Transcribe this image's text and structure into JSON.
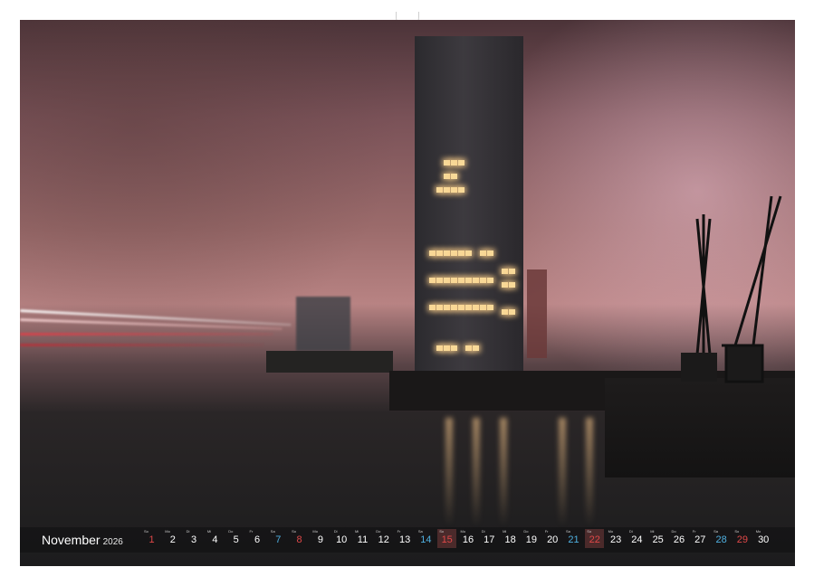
{
  "calendar": {
    "month": "November",
    "year": "2026",
    "days": [
      {
        "dow": "So",
        "num": "1",
        "type": "sun"
      },
      {
        "dow": "Mo",
        "num": "2",
        "type": "wk"
      },
      {
        "dow": "Di",
        "num": "3",
        "type": "wk"
      },
      {
        "dow": "Mi",
        "num": "4",
        "type": "wk"
      },
      {
        "dow": "Do",
        "num": "5",
        "type": "wk"
      },
      {
        "dow": "Fr",
        "num": "6",
        "type": "wk"
      },
      {
        "dow": "Sa",
        "num": "7",
        "type": "sat"
      },
      {
        "dow": "So",
        "num": "8",
        "type": "sun"
      },
      {
        "dow": "Mo",
        "num": "9",
        "type": "wk"
      },
      {
        "dow": "Di",
        "num": "10",
        "type": "wk"
      },
      {
        "dow": "Mi",
        "num": "11",
        "type": "wk"
      },
      {
        "dow": "Do",
        "num": "12",
        "type": "wk"
      },
      {
        "dow": "Fr",
        "num": "13",
        "type": "wk"
      },
      {
        "dow": "Sa",
        "num": "14",
        "type": "sat"
      },
      {
        "dow": "So",
        "num": "15",
        "type": "hol"
      },
      {
        "dow": "Mo",
        "num": "16",
        "type": "wk"
      },
      {
        "dow": "Di",
        "num": "17",
        "type": "wk"
      },
      {
        "dow": "Mi",
        "num": "18",
        "type": "wk"
      },
      {
        "dow": "Do",
        "num": "19",
        "type": "wk"
      },
      {
        "dow": "Fr",
        "num": "20",
        "type": "wk"
      },
      {
        "dow": "Sa",
        "num": "21",
        "type": "sat"
      },
      {
        "dow": "So",
        "num": "22",
        "type": "hol"
      },
      {
        "dow": "Mo",
        "num": "23",
        "type": "wk"
      },
      {
        "dow": "Di",
        "num": "24",
        "type": "wk"
      },
      {
        "dow": "Mi",
        "num": "25",
        "type": "wk"
      },
      {
        "dow": "Do",
        "num": "26",
        "type": "wk"
      },
      {
        "dow": "Fr",
        "num": "27",
        "type": "wk"
      },
      {
        "dow": "Sa",
        "num": "28",
        "type": "sat"
      },
      {
        "dow": "So",
        "num": "29",
        "type": "sun"
      },
      {
        "dow": "Mo",
        "num": "30",
        "type": "wk"
      }
    ]
  }
}
